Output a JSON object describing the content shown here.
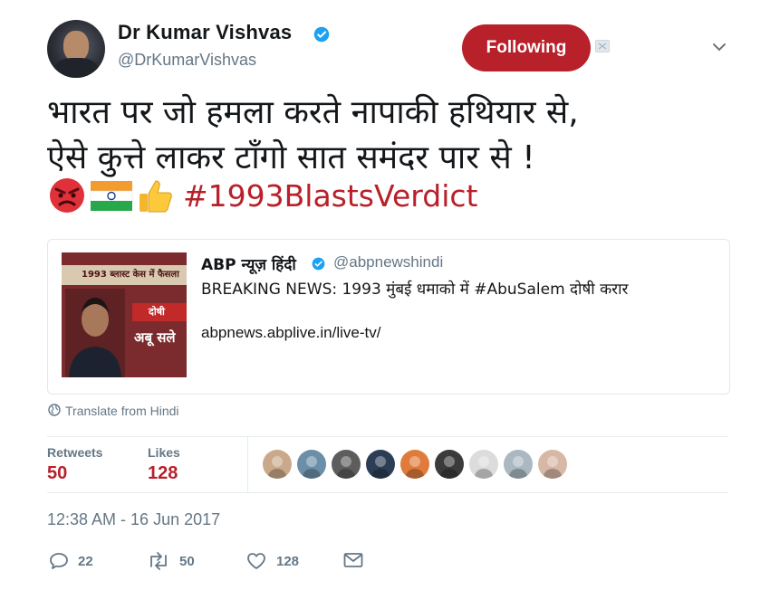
{
  "author": {
    "name": "Dr Kumar Vishvas",
    "handle": "@DrKumarVishvas",
    "follow_label": "Following"
  },
  "tweet": {
    "text": "भारत पर जो हमला करते नापाकी हथियार से,\nऐसे कुत्ते लाकर टाँगो सात समंदर पार से !",
    "emojis": [
      "angry-face-emoji",
      "india-flag-emoji",
      "thumbs-up-emoji"
    ],
    "hashtag": "#1993BlastsVerdict"
  },
  "quoted": {
    "name": "ABP न्यूज़ हिंदी",
    "handle": "@abpnewshindi",
    "text": "BREAKING NEWS: 1993 मुंबई धमाको में #AbuSalem दोषी करार",
    "link": "abpnews.abplive.in/live-tv/",
    "image_texts": {
      "banner": "1993 ब्लास्ट केस में फैसला",
      "badge": "दोषी",
      "caption": "अबू सले"
    }
  },
  "translate_label": "Translate from Hindi",
  "stats": {
    "retweets_label": "Retweets",
    "retweets": "50",
    "likes_label": "Likes",
    "likes": "128"
  },
  "likers": [
    {
      "name": "liker-1",
      "bg": "#c9a98a"
    },
    {
      "name": "liker-2",
      "bg": "#6b8fa8"
    },
    {
      "name": "liker-3",
      "bg": "#5d5d5d"
    },
    {
      "name": "liker-4",
      "bg": "#2c3e55"
    },
    {
      "name": "liker-5",
      "bg": "#e07b3c"
    },
    {
      "name": "liker-6",
      "bg": "#3b3b3b"
    },
    {
      "name": "liker-7",
      "bg": "#dcdcdc"
    },
    {
      "name": "liker-8",
      "bg": "#aab8c2"
    },
    {
      "name": "liker-9",
      "bg": "#d7b7a5"
    }
  ],
  "timestamp": "12:38 AM - 16 Jun 2017",
  "actions": {
    "replies": "22",
    "retweets": "50",
    "likes": "128"
  },
  "colors": {
    "accent": "#b8202a",
    "muted": "#657786",
    "verified": "#1da1f2",
    "border": "#e1e8ed"
  }
}
